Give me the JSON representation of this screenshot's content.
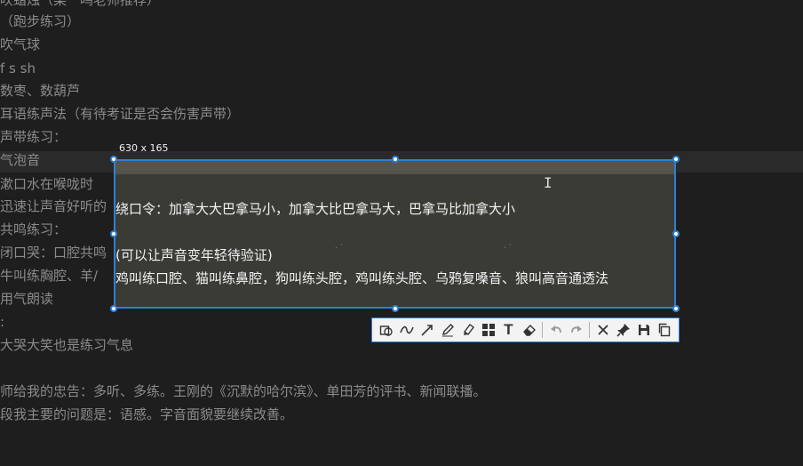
{
  "editor": {
    "lines": [
      "吹蜡烛（栾一鸣老师推荐）",
      "（跑步练习）",
      "吹气球",
      "f s sh",
      "数枣、数葫芦",
      "耳语练声法（有待考证是否会伤害声带）",
      "声带练习：",
      "气泡音",
      "漱口水在喉咙时",
      "迅速让声音好听的",
      "共鸣练习：",
      "闭口哭：口腔共鸣",
      "牛叫练胸腔、羊/",
      "用气朗读",
      ":",
      "大哭大笑也是练习气息",
      "",
      "师给我的忠告：多听、多练。王刚的《沉默的哈尔滨》、单田芳的评书、新闻联播。",
      "段我主要的问题是：语感。字音面貌要继续改善。"
    ]
  },
  "selection": {
    "size_label": "630 x 165",
    "text_lines": [
      "绕口令：加拿大大巴拿马小，加拿大比巴拿马大，巴拿马比加拿大小",
      "(可以让声音变年轻待验证)",
      "鸡叫练口腔、猫叫练鼻腔，狗叫练头腔，鸡叫练头腔、乌鸦复嗓音、狼叫高音通透法"
    ]
  },
  "toolbar": {
    "tools": [
      {
        "name": "rectangle-ellipse-icon",
        "tooltip": ""
      },
      {
        "name": "curve-icon",
        "tooltip": ""
      },
      {
        "name": "arrow-icon",
        "tooltip": ""
      },
      {
        "name": "pen-icon",
        "tooltip": ""
      },
      {
        "name": "marker-icon",
        "tooltip": ""
      },
      {
        "name": "mosaic-icon",
        "tooltip": ""
      },
      {
        "name": "text-icon",
        "tooltip": ""
      },
      {
        "name": "eraser-icon",
        "tooltip": ""
      },
      {
        "name": "undo-icon",
        "tooltip": ""
      },
      {
        "name": "redo-icon",
        "tooltip": ""
      },
      {
        "name": "close-icon",
        "tooltip": ""
      },
      {
        "name": "pin-icon",
        "tooltip": ""
      },
      {
        "name": "save-icon",
        "tooltip": ""
      },
      {
        "name": "copy-icon",
        "tooltip": ""
      }
    ],
    "text_tool_glyph": "T"
  },
  "colors": {
    "background": "#1e1e1e",
    "text": "#8b8b8b",
    "selection_border": "#2f7fd6",
    "toolbar_bg": "#f3f3f3"
  }
}
